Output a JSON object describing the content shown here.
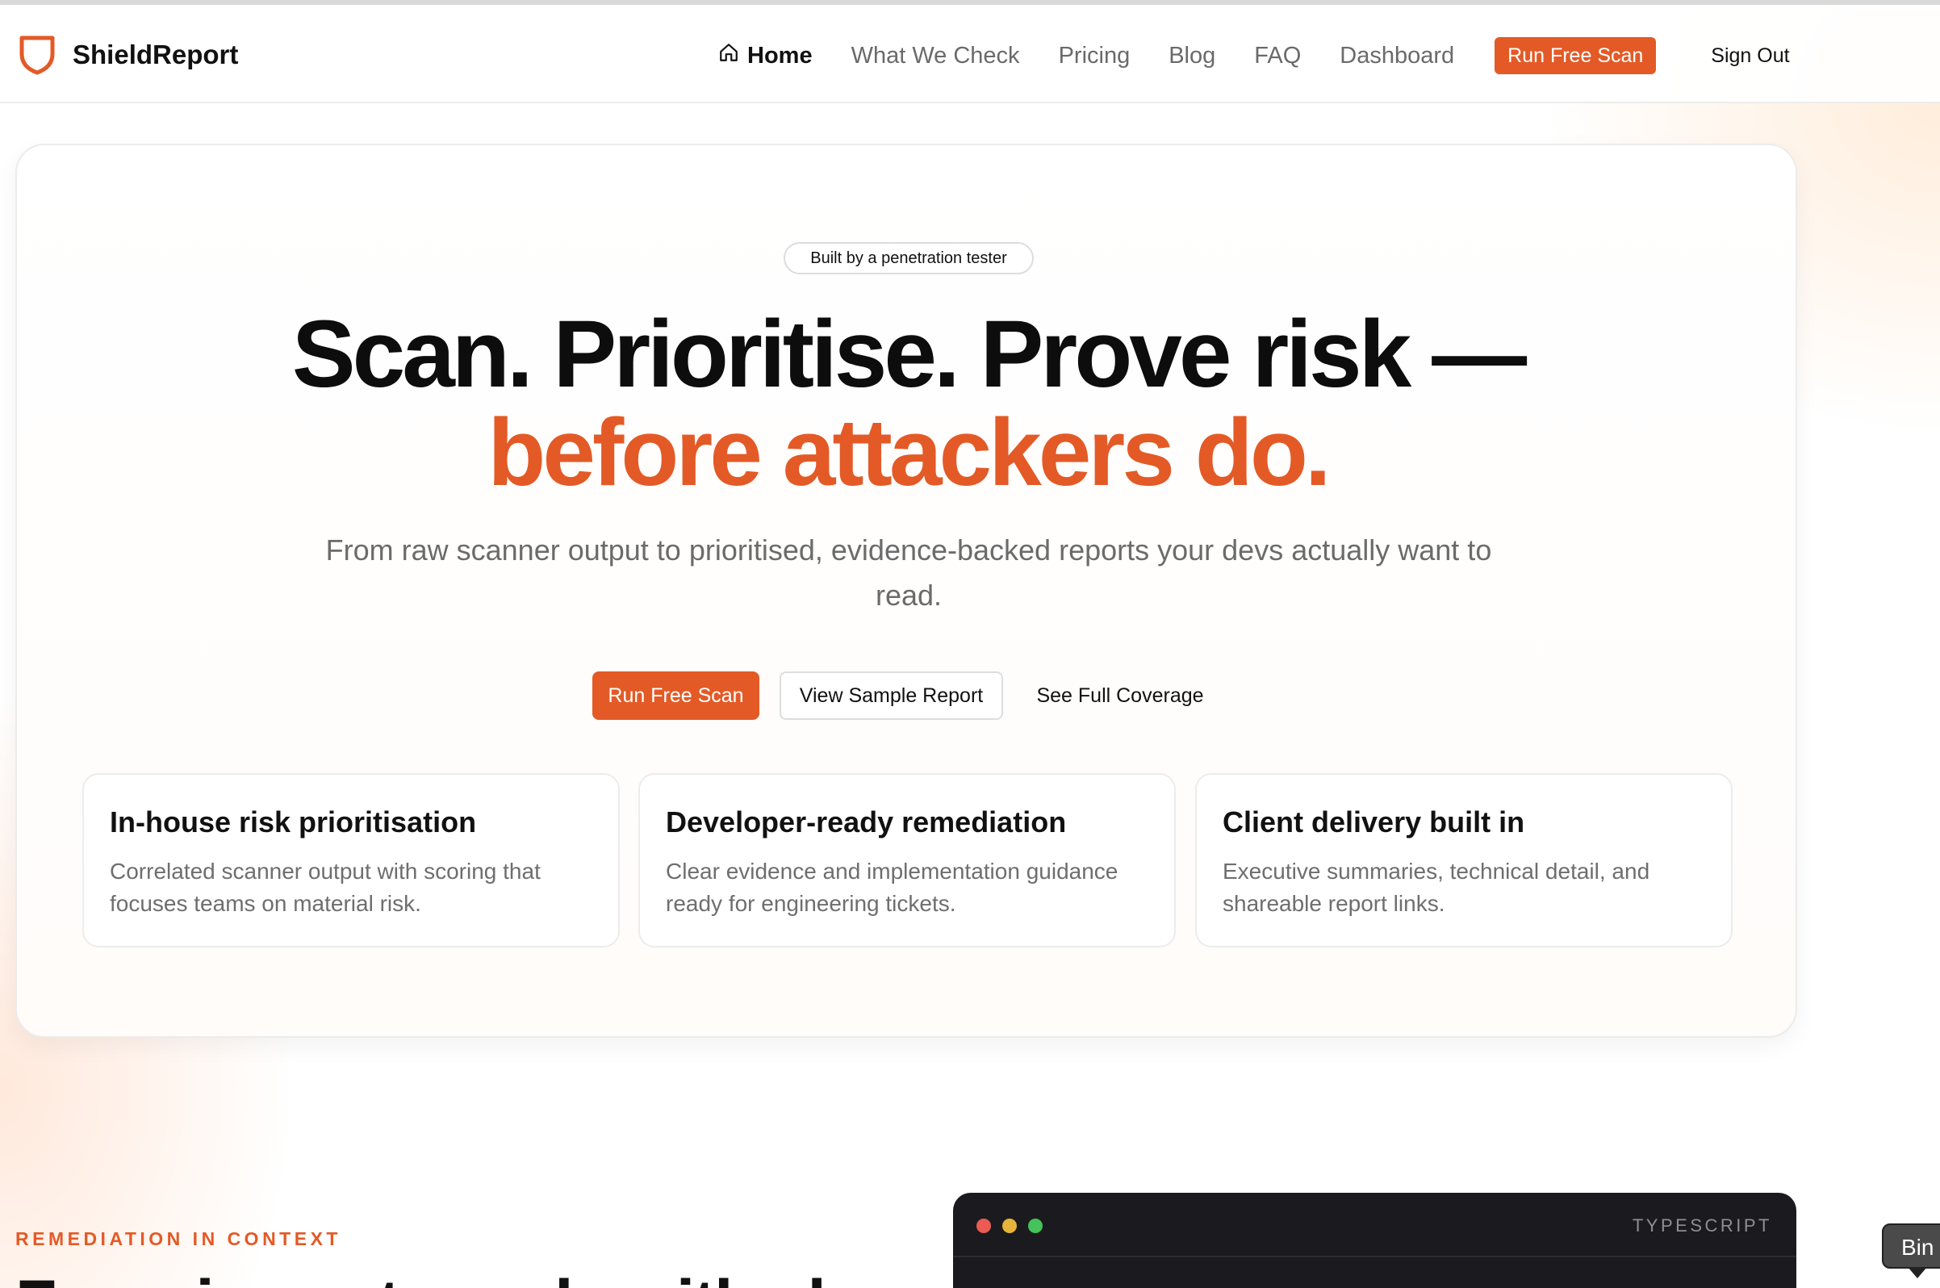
{
  "header": {
    "brand": "ShieldReport",
    "nav": {
      "home": "Home",
      "what_we_check": "What We Check",
      "pricing": "Pricing",
      "blog": "Blog",
      "faq": "FAQ",
      "dashboard": "Dashboard",
      "cta": "Run Free Scan",
      "sign_out": "Sign Out"
    }
  },
  "hero": {
    "badge": "Built by a penetration tester",
    "headline_line1": "Scan. Prioritise. Prove risk —",
    "headline_line2": "before attackers do.",
    "subhead": "From raw scanner output to prioritised, evidence-backed reports your devs actually want to read.",
    "buttons": {
      "primary": "Run Free Scan",
      "secondary": "View Sample Report",
      "tertiary": "See Full Coverage"
    },
    "features": [
      {
        "title": "In-house risk prioritisation",
        "text": "Correlated scanner output with scoring that focuses teams on material risk."
      },
      {
        "title": "Developer-ready remediation",
        "text": "Clear evidence and implementation guidance ready for engineering tickets."
      },
      {
        "title": "Client delivery built in",
        "text": "Executive summaries, technical detail, and shareable report links."
      }
    ]
  },
  "remediation": {
    "eyebrow": "REMEDIATION IN CONTEXT",
    "title_partial": "From issue to code with clear explanation",
    "code_window": {
      "language": "TYPESCRIPT"
    }
  },
  "tooltip": {
    "text": "Bin"
  },
  "colors": {
    "accent": "#e35a26",
    "text_primary": "#111111",
    "text_muted": "#6b6b6b",
    "code_bg": "#1b1b1f"
  },
  "icons": {
    "brand": "shield-icon",
    "home": "home-icon"
  }
}
